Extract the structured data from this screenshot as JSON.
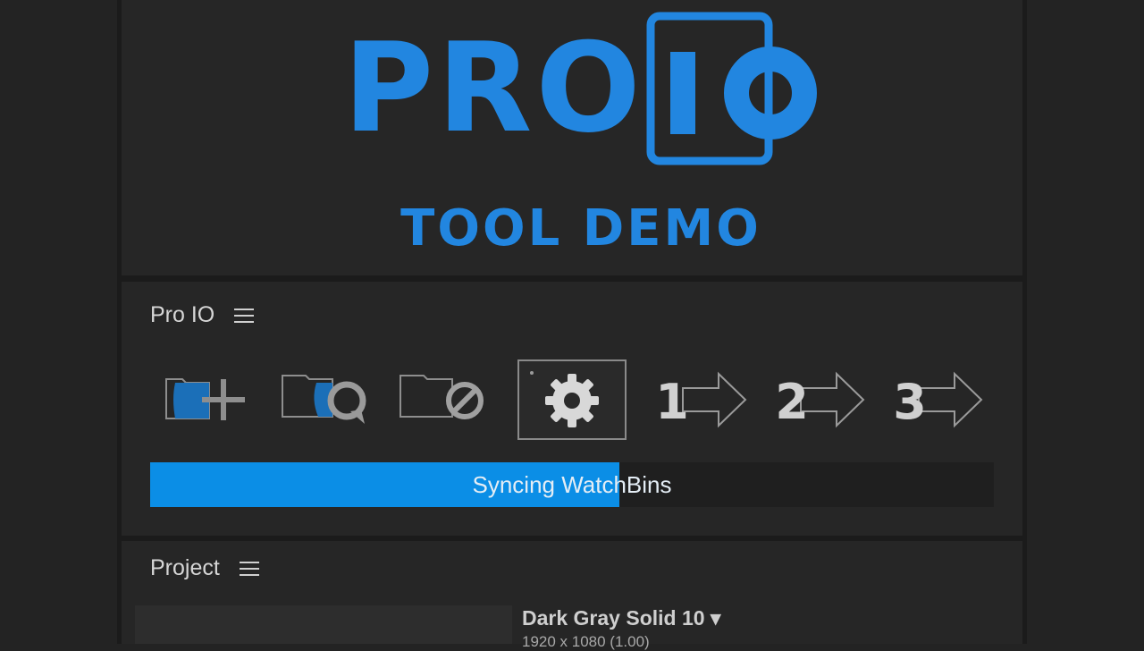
{
  "logo": {
    "word": "PRO",
    "io_text": "IO",
    "subtitle": "TOOL DEMO",
    "color": "#2286e0"
  },
  "proio_panel": {
    "title": "Pro IO",
    "tools": [
      {
        "name": "add-watchbin",
        "icon": "folder-plus-icon"
      },
      {
        "name": "refresh-watchbin",
        "icon": "folder-refresh-icon"
      },
      {
        "name": "disable-watchbin",
        "icon": "folder-block-icon"
      },
      {
        "name": "settings",
        "icon": "gear-icon",
        "selected": true
      },
      {
        "name": "preset-1",
        "label": "1",
        "icon": "arrow-right-icon"
      },
      {
        "name": "preset-2",
        "label": "2",
        "icon": "arrow-right-icon"
      },
      {
        "name": "preset-3",
        "label": "3",
        "icon": "arrow-right-icon"
      }
    ],
    "progress": {
      "label": "Syncing WatchBins",
      "fraction": 0.556,
      "color": "#0b8ee6"
    }
  },
  "project_panel": {
    "title": "Project",
    "asset": {
      "name": "Dark Gray Solid 10 ▾",
      "dims": "1920 x 1080 (1.00)"
    }
  }
}
